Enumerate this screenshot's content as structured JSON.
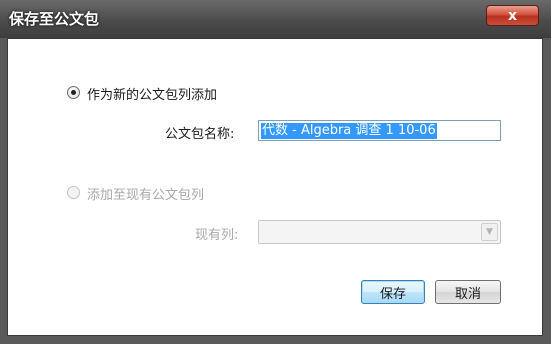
{
  "dialog": {
    "title": "保存至公文包",
    "close_label": "x"
  },
  "option_new": {
    "label": "作为新的公文包列添加",
    "selected": true,
    "name_label": "公文包名称:",
    "name_value": "代数 - Algebra 调查 1 10-06"
  },
  "option_existing": {
    "label": "添加至现有公文包列",
    "selected": false,
    "list_label": "现有列:",
    "list_value": ""
  },
  "buttons": {
    "save": "保存",
    "cancel": "取消"
  },
  "colors": {
    "titlebar": "#4c4c4c",
    "close": "#c9503c",
    "selection": "#3399ff"
  }
}
